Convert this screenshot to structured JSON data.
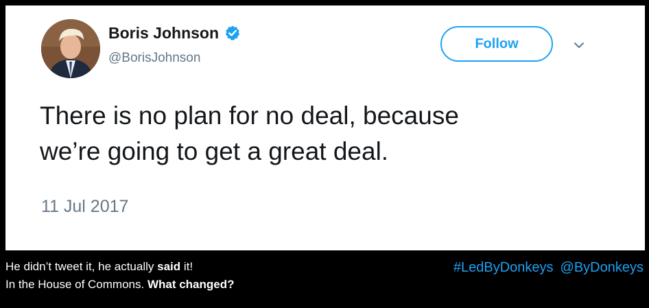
{
  "tweet": {
    "author_name": "Boris Johnson",
    "author_handle": "@BorisJohnson",
    "follow_label": "Follow",
    "text_line1": "There is no plan for no deal, because",
    "text_line2": "we’re going to get a great deal.",
    "timestamp": "11 Jul 2017",
    "verified": true,
    "avatar_icon": "profile-photo",
    "verified_icon": "verified-badge-icon",
    "menu_icon": "chevron-down-icon"
  },
  "caption": {
    "line1_prefix": "He didn’t tweet it, he actually ",
    "line1_bold": "said",
    "line1_suffix": " it!",
    "line2_prefix": "In the House of Commons. ",
    "line2_bold": "What changed?",
    "hashtag": "#LedByDonkeys",
    "mention": "@ByDonkeys"
  },
  "colors": {
    "background": "#000000",
    "card": "#ffffff",
    "accent": "#1da1f2",
    "text_primary": "#14171a",
    "text_secondary": "#657786",
    "caption_text": "#ffffff"
  }
}
